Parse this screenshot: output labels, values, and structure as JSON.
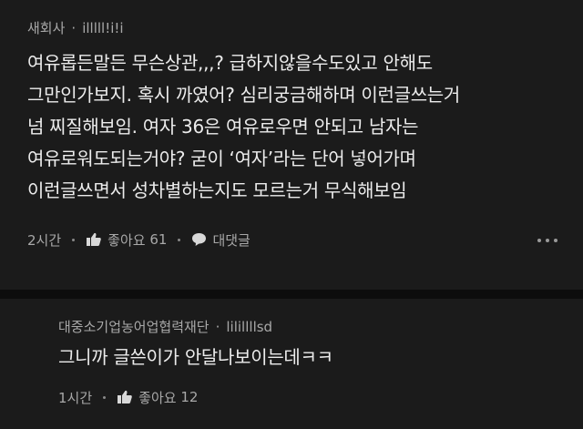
{
  "comment": {
    "author": "새회사",
    "username": "illlll!i!i",
    "lines": [
      "여유롭든말든 무슨상관,,,? 급하지않을수도있고 안해도",
      "그만인가보지. 혹시 까였어? 심리궁금해하며 이런글쓰는거",
      "넘 찌질해보임. 여자 36은 여유로우면 안되고 남자는",
      "여유로워도되는거야? 굳이 ‘여자’라는 단어 넣어가며",
      "이런글쓰면서 성차별하는지도 모르는거 무식해보임"
    ],
    "time": "2시간",
    "like_label": "좋아요",
    "like_count": "61",
    "reply_label": "대댓글"
  },
  "reply": {
    "author": "대중소기업농어업협력재단",
    "username": "lilillllsd",
    "text": "그니까 글쓴이가 안달나보이는데ㅋㅋ",
    "time": "1시간",
    "like_label": "좋아요",
    "like_count": "12"
  },
  "icons": {
    "like": "thumbs-up-icon",
    "reply": "speech-bubble-icon",
    "more": "more-horizontal-icon"
  },
  "colors": {
    "background": "#1b1b1b",
    "separator": "#0d0d0d",
    "text": "#ececec",
    "meta": "#a8a8a8"
  }
}
